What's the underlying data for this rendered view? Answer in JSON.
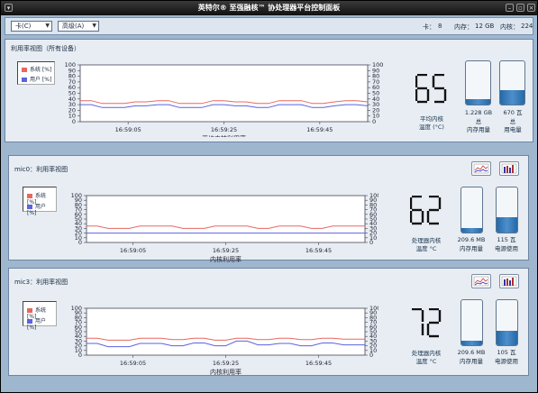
{
  "window": {
    "title": "英特尔® 至强融核™ 协处理器平台控制面板"
  },
  "toolbar": {
    "card_combo": "卡(C)",
    "advanced_combo": "高级(A)",
    "cards_label": "卡：",
    "cards_value": "8",
    "memory_label": "内存：",
    "memory_value": "12 GB",
    "cores_label": "内核：",
    "cores_value": "224"
  },
  "legend": {
    "system": "系统 [%]",
    "user": "用户 [%]"
  },
  "colors": {
    "system": "#e8685f",
    "user": "#5a63e0",
    "chart_bg": "#ffffff",
    "gauge": "#2e74b5"
  },
  "panels": [
    {
      "title": "利用率视图（所有设备）",
      "xlabel": "平均内核利用率",
      "lcd": "65",
      "lcd_label": [
        "平均内核",
        "温度 (°C)"
      ],
      "gauge1_value": "1.228 GB",
      "gauge1_label": [
        "总",
        "内存用量"
      ],
      "gauge1_level": 0.12,
      "gauge2_value": "670 瓦",
      "gauge2_label": [
        "总",
        "用电量"
      ],
      "gauge2_level": 0.33
    },
    {
      "title": "mic0：利用率视图",
      "xlabel": "内核利用率",
      "lcd": "62",
      "lcd_label": [
        "处理器内核",
        "温度 °C"
      ],
      "gauge1_value": "209.6 MB",
      "gauge1_label": [
        "内存用量"
      ],
      "gauge1_level": 0.1,
      "gauge2_value": "115 瓦",
      "gauge2_label": [
        "电源使用"
      ],
      "gauge2_level": 0.35
    },
    {
      "title": "mic3：利用率视图",
      "xlabel": "内核利用率",
      "lcd": "72",
      "lcd_label": [
        "处理器内核",
        "温度 °C"
      ],
      "gauge1_value": "209.6 MB",
      "gauge1_label": [
        "内存用量"
      ],
      "gauge1_level": 0.1,
      "gauge2_value": "105 瓦",
      "gauge2_label": [
        "电源使用"
      ],
      "gauge2_level": 0.32
    }
  ],
  "chart_data": [
    {
      "type": "line",
      "x": [
        "16:59:05",
        "16:59:25",
        "16:59:45"
      ],
      "xlabel": "平均内核利用率",
      "ylim": [
        0,
        100
      ],
      "yticks": [
        0,
        10,
        20,
        30,
        40,
        50,
        60,
        70,
        80,
        90,
        100
      ],
      "series": [
        {
          "name": "系统 [%]",
          "values": [
            37,
            37,
            32,
            32,
            32,
            35,
            35,
            37,
            37,
            32,
            32,
            32,
            37,
            37,
            35,
            35,
            32,
            32,
            37,
            37,
            37,
            32,
            32,
            35,
            37,
            37,
            35
          ]
        },
        {
          "name": "用户 [%]",
          "values": [
            30,
            30,
            25,
            25,
            25,
            28,
            28,
            30,
            30,
            25,
            25,
            25,
            30,
            30,
            28,
            28,
            25,
            25,
            30,
            30,
            30,
            25,
            25,
            28,
            30,
            30,
            28
          ]
        }
      ]
    },
    {
      "type": "line",
      "x": [
        "16:59:05",
        "16:59:25",
        "16:59:45"
      ],
      "xlabel": "内核利用率",
      "ylim": [
        0,
        100
      ],
      "yticks": [
        0,
        10,
        20,
        30,
        40,
        50,
        60,
        70,
        80,
        90,
        100
      ],
      "series": [
        {
          "name": "系统 [%]",
          "values": [
            35,
            35,
            30,
            30,
            30,
            35,
            35,
            35,
            35,
            30,
            30,
            30,
            35,
            35,
            35,
            35,
            30,
            30,
            35,
            35,
            35,
            30,
            30,
            35,
            35,
            35,
            35
          ]
        },
        {
          "name": "用户 [%]",
          "values": [
            20,
            20,
            20,
            20,
            20,
            20,
            20,
            20,
            20,
            20,
            20,
            20,
            20,
            20,
            20,
            20,
            20,
            20,
            20,
            20,
            20,
            20,
            20,
            20,
            20,
            20,
            20
          ]
        }
      ]
    },
    {
      "type": "line",
      "x": [
        "16:59:05",
        "16:59:25",
        "16:59:45"
      ],
      "xlabel": "内核利用率",
      "ylim": [
        0,
        100
      ],
      "yticks": [
        0,
        10,
        20,
        30,
        40,
        50,
        60,
        70,
        80,
        90,
        100
      ],
      "series": [
        {
          "name": "系统 [%]",
          "values": [
            36,
            36,
            32,
            32,
            32,
            36,
            36,
            36,
            33,
            33,
            36,
            36,
            32,
            32,
            36,
            36,
            33,
            33,
            36,
            36,
            33,
            33,
            36,
            36,
            34,
            34,
            34
          ]
        },
        {
          "name": "用户 [%]",
          "values": [
            25,
            25,
            18,
            18,
            18,
            25,
            25,
            25,
            20,
            20,
            26,
            26,
            20,
            20,
            30,
            30,
            22,
            22,
            25,
            25,
            20,
            20,
            26,
            26,
            22,
            22,
            22
          ]
        }
      ]
    }
  ]
}
